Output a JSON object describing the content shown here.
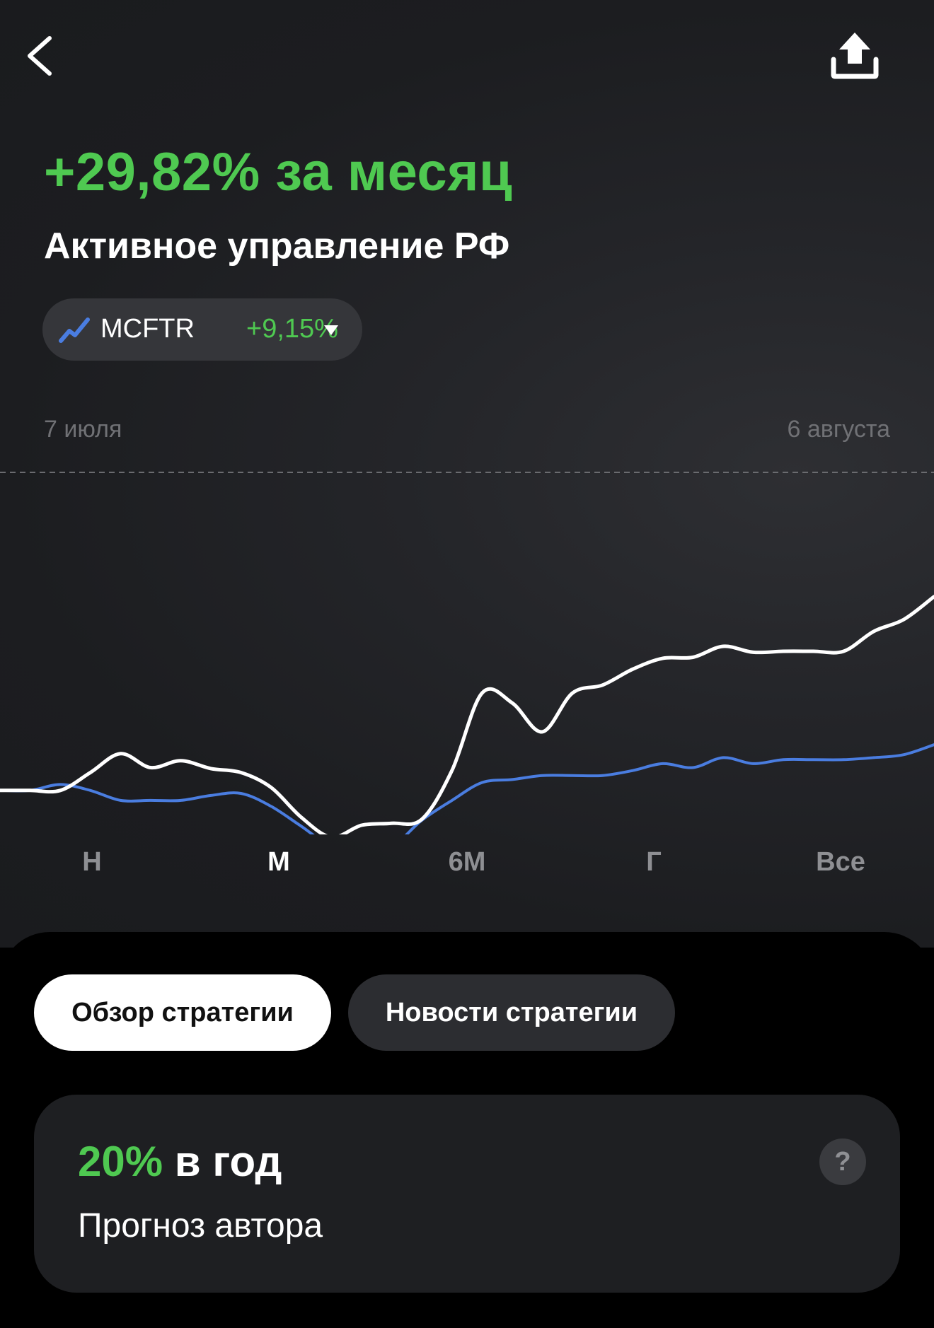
{
  "header": {
    "back_icon": "chevron-left-icon",
    "share_icon": "share-upload-icon"
  },
  "summary": {
    "headline": "+29,82% за месяц",
    "strategy_name": "Активное управление РФ"
  },
  "benchmark": {
    "icon": "trend-line-icon",
    "name": "MCFTR",
    "change": "+9,15%",
    "caret_icon": "caret-down-icon"
  },
  "chart_range": {
    "start_label": "7 июля",
    "end_label": "6 августа"
  },
  "chart_data": {
    "type": "line",
    "title": "",
    "xlabel": "",
    "ylabel": "",
    "x_start": "7 июля",
    "x_end": "6 августа",
    "colors": {
      "strategy": "#ffffff",
      "benchmark": "#4a7de0"
    },
    "ylim": [
      -3,
      32
    ],
    "series": [
      {
        "name": "",
        "color": "#ffffff",
        "values": [
          0,
          0,
          0,
          1.8,
          3.7,
          2.3,
          3.0,
          2.2,
          1.8,
          0.3,
          -2.7,
          -4.7,
          -3.5,
          -3.3,
          -2.9,
          2.0,
          9.8,
          8.8,
          5.9,
          9.8,
          10.6,
          12.2,
          13.3,
          13.4,
          14.5,
          13.9,
          14.0,
          14.0,
          14.0,
          16.0,
          17.2,
          19.5
        ]
      },
      {
        "name": "MCFTR",
        "color": "#4a7de0",
        "values": [
          0,
          0,
          0.6,
          0.0,
          -1.0,
          -1.0,
          -1.0,
          -0.5,
          -0.3,
          -1.6,
          -3.6,
          -5.6,
          -5.6,
          -5.6,
          -3.0,
          -1.0,
          0.8,
          1.1,
          1.5,
          1.5,
          1.5,
          2.0,
          2.7,
          2.3,
          3.3,
          2.7,
          3.1,
          3.1,
          3.1,
          3.3,
          3.6,
          4.6
        ]
      }
    ],
    "baseline_dashed": true
  },
  "periods": {
    "items": [
      "Н",
      "М",
      "6М",
      "Г",
      "Все"
    ],
    "active_index": 1
  },
  "tabs": {
    "overview_label": "Обзор стратегии",
    "news_label": "Новости стратегии"
  },
  "forecast": {
    "percent": "20%",
    "suffix": " в год",
    "label": "Прогноз автора",
    "help_label": "?"
  }
}
